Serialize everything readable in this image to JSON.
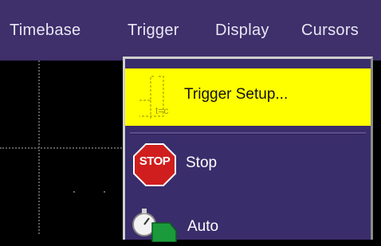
{
  "menubar": {
    "items": [
      "Timebase",
      "Trigger",
      "Display",
      "Cursors"
    ]
  },
  "trigger_menu": {
    "items": [
      {
        "label": "Trigger Setup...",
        "icon": "trigger-setup-icon",
        "icon_text": "t=c",
        "highlight": "#ffff00"
      },
      {
        "label": "Stop",
        "icon": "stop-sign-icon",
        "icon_text": "STOP"
      },
      {
        "label": "Auto",
        "icon": "stopwatch-go-icon"
      }
    ]
  },
  "colors": {
    "menubar_bg": "#3f2f6b",
    "dropdown_bg": "#3a2d6b",
    "highlight": "#ffff00",
    "stop_red": "#d01e1e",
    "go_green": "#1a9a3a"
  }
}
